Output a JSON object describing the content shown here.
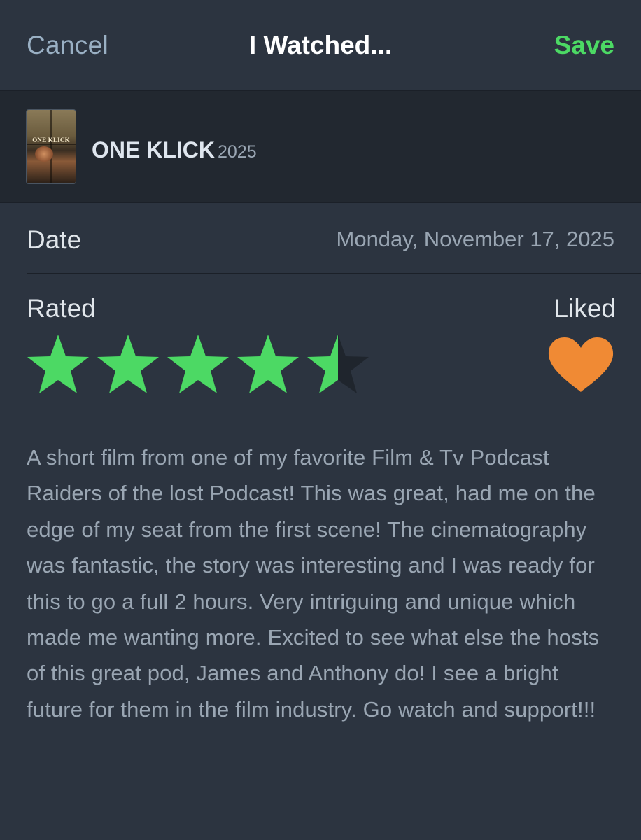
{
  "header": {
    "cancel_label": "Cancel",
    "title": "I Watched...",
    "save_label": "Save"
  },
  "film": {
    "title": "ONE KLICK",
    "year": "2025",
    "poster_text": "ONE KLICK"
  },
  "date": {
    "label": "Date",
    "value": "Monday, November 17, 2025"
  },
  "rating": {
    "label": "Rated",
    "stars_value": 4.5,
    "stars_max": 5
  },
  "liked": {
    "label": "Liked",
    "is_liked": true
  },
  "review": {
    "text": "A short film from one of my favorite Film & Tv Podcast Raiders of the lost Podcast! This was great, had me on the edge of my seat from the first scene! The cinematography was fantastic, the story was interesting and I was ready for this to go a full 2 hours. Very intriguing and unique which made me wanting more. Excited to see what else the hosts of this great pod, James and Anthony do! I see a bright future for them in the film industry. Go watch and support!!!"
  },
  "colors": {
    "background": "#2c3440",
    "film_bar": "#222830",
    "accent_green": "#4cd964",
    "star_empty": "#1f252d",
    "heart_orange": "#f08a34",
    "primary_text": "#e1e6eb",
    "secondary_text": "#9aa6b3"
  },
  "icons": {
    "star": "star-icon",
    "heart": "heart-icon"
  }
}
